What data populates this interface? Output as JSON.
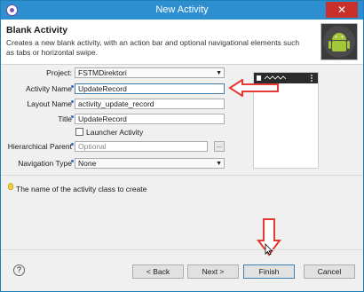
{
  "window": {
    "title": "New Activity",
    "close_glyph": "✕"
  },
  "header": {
    "title": "Blank Activity",
    "description": "Creates a new blank activity, with an action bar and optional navigational elements such as tabs or horizontal swipe."
  },
  "form": {
    "project_label": "Project:",
    "project_value": "FSTMDirektori",
    "activity_label": "Activity Name",
    "activity_value": "UpdateRecord",
    "layout_label": "Layout Name",
    "layout_value": "activity_update_record",
    "title_label": "Title",
    "title_value": "UpdateRecord",
    "launcher_label": "Launcher Activity",
    "hierarchical_label": "Hierarchical Parent",
    "hierarchical_placeholder": "Optional",
    "browse_label": "...",
    "navigation_label": "Navigation Type",
    "navigation_value": "None"
  },
  "hint": "The name of the activity class to create",
  "buttons": {
    "help": "?",
    "back": "< Back",
    "next": "Next >",
    "finish": "Finish",
    "cancel": "Cancel"
  },
  "icons": [
    "app-icon",
    "android-logo-icon",
    "info-icon",
    "dropdown-arrow-icon",
    "lightbulb-icon",
    "help-icon",
    "annotation-arrow-icon",
    "mouse-cursor-icon"
  ],
  "colors": {
    "titlebar": "#2d8fd0",
    "close": "#c9302c",
    "annotation": "#e53935",
    "android_green": "#a4c639"
  }
}
